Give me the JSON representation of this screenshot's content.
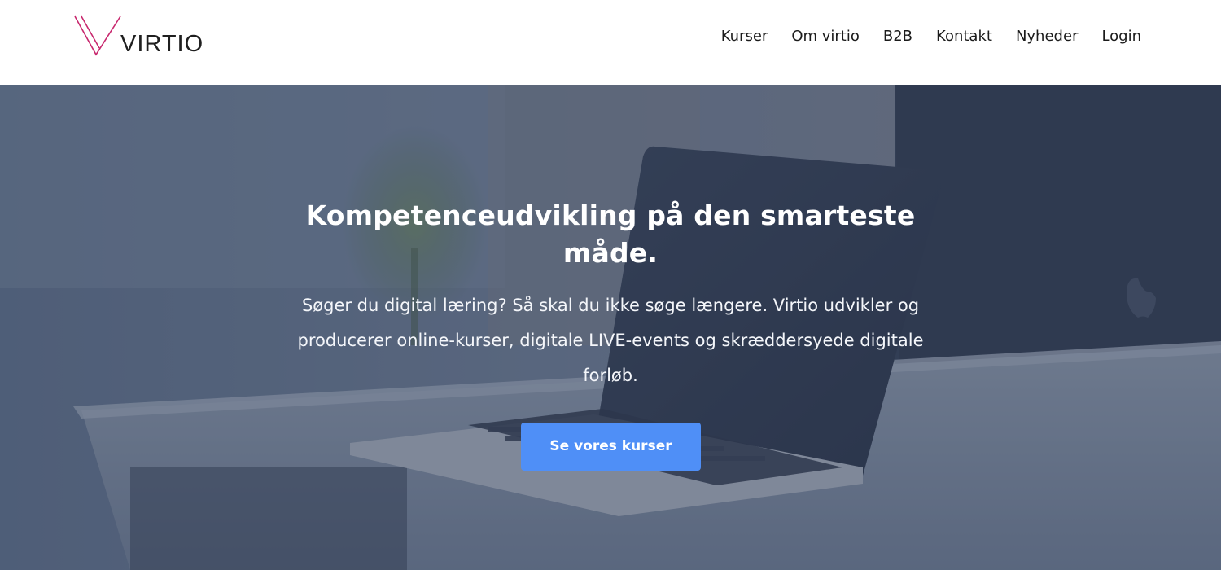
{
  "brand": {
    "name": "VIRTIO",
    "accent_color": "#c8286e"
  },
  "nav": {
    "items": [
      {
        "label": "Kurser"
      },
      {
        "label": "Om virtio"
      },
      {
        "label": "B2B"
      },
      {
        "label": "Kontakt"
      },
      {
        "label": "Nyheder"
      },
      {
        "label": "Login"
      }
    ]
  },
  "hero": {
    "title": "Kompetenceudvikling på den smarteste måde.",
    "subtitle": "Søger du digital læring? Så skal du ikke søge længere. Virtio udvikler og producerer online-kurser, digitale LIVE-events og skræddersyede digitale forløb.",
    "cta_label": "Se vores kurser",
    "cta_color": "#4f8ff7",
    "background_image": "desk-with-laptop-photo"
  }
}
